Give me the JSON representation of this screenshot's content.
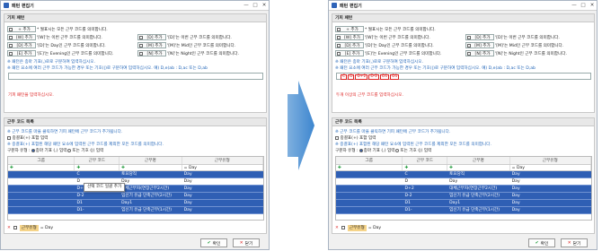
{
  "window": {
    "title": "패턴 편집기",
    "minimize": "—",
    "maximize": "□",
    "close": "✕"
  },
  "pattern": {
    "section_title": "기피 패턴",
    "tokens": [
      {
        "button": "+ 추가",
        "desc": "* 뭘표시는 모든 근무 코드를 의미합니다."
      },
      {
        "button": "[W] 추가",
        "desc": "'[W]'는 이번 근무 코드를 의미합니다."
      },
      {
        "button": "[D] 추가",
        "desc": "'[D]'는 이번 근무 코드를 의미합니다."
      },
      {
        "button": "[D] 추가",
        "desc": "'[D]'는 Day인 근무 코드를 의미합니다."
      },
      {
        "button": "[M] 추가",
        "desc": "'[M]'는 Mid인 근무 코드를 의미합니다."
      },
      {
        "button": "[E] 추가",
        "desc": "'[E]'는 Evening인 근무 코드를 의미합니다."
      },
      {
        "button": "[N] 추가",
        "desc": "'[N]'는 Night인 근무 코드를 의미합니다."
      }
    ],
    "note1": "※ 패턴은 종마 기표(,)로로 구분하여 입력하십시오.",
    "note2": "※ 패턴 요소에 여러 근무 코드가 가능한 경우 또는 기호(|)로 구분하여 입력하십시오. 예) D,e(ab : D,ac 또는 D,ab",
    "message_left": "기피 패턴을 입력하십시오.",
    "message_right": "두개 이상의 근무 코드를 입력하십시오.",
    "entered_tokens": [
      "C",
      "D",
      "D+2",
      "D-2",
      "D1",
      "D1"
    ]
  },
  "codes": {
    "section_title": "근무 코드 목록",
    "note1": "※ 근무 코드를 마을 클릭하면 기피 패턴에 근무 코드가 추가됩니다.",
    "checkbox_label": "중결표(+) 포함 입력",
    "note2": "※ 중결표(+) 포함된 해당 패턴 요소에 입력된 근무 코드를 제외한 모든 코드를 의미합니다.",
    "split_label": "구분자 유형 :",
    "radio1": "종마 기표 (,) 입력",
    "radio2": "또는 기호 (|) 입력",
    "columns": [
      "그룹",
      "근무 코드",
      "근무명",
      "근무유형"
    ],
    "filter_type": "= Day",
    "rows": [
      {
        "group": "",
        "code": "C",
        "name": "토요당직",
        "type": "Day"
      },
      {
        "group": "",
        "code": "D",
        "name": "Day",
        "type": "Day"
      },
      {
        "group": "",
        "code": "D+2",
        "name": "대체근무자(연장근무2시간)",
        "type": "Day"
      },
      {
        "group": "",
        "code": "D-2",
        "name": "임신기 유급 단축근무(2시간)",
        "type": "Day"
      },
      {
        "group": "",
        "code": "D1",
        "name": "Day1",
        "type": "Day"
      },
      {
        "group": "",
        "code": "D1-",
        "name": "임신기 유급 단축근무(1시간)",
        "type": "Day"
      }
    ],
    "context_menu": "선택 코드 일괄 추가",
    "filter_chip": "근무유형",
    "filter_value": "= Day"
  },
  "buttons": {
    "ok": "확인",
    "close": "닫기"
  },
  "colors": {
    "selection": "#2f5fb4",
    "error": "#dd2222",
    "note": "#2366b8"
  }
}
